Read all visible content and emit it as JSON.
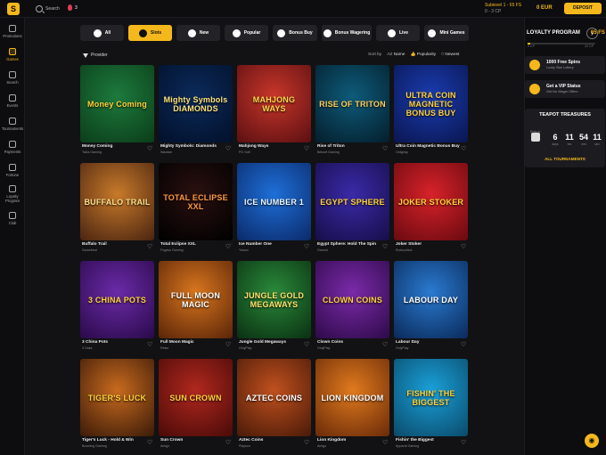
{
  "header": {
    "logo": "S",
    "search_label": "Search",
    "notifications_count": "3",
    "user_name": "Subievel 1 - 65 FS",
    "user_sub": "0 - 3 CP",
    "balance": "0 EUR",
    "deposit_label": "DEPOSIT"
  },
  "sidebar": {
    "items": [
      {
        "label": "Promotions"
      },
      {
        "label": "Games"
      },
      {
        "label": "Search"
      },
      {
        "label": "Events"
      },
      {
        "label": "Tournaments"
      },
      {
        "label": "Payments"
      },
      {
        "label": "Fortune"
      },
      {
        "label": "Loyalty Program"
      },
      {
        "label": "Club"
      }
    ]
  },
  "categories": [
    {
      "label": "All"
    },
    {
      "label": "Slots"
    },
    {
      "label": "New"
    },
    {
      "label": "Popular"
    },
    {
      "label": "Bonus Buy"
    },
    {
      "label": "Bonus Wagering"
    },
    {
      "label": "Live"
    },
    {
      "label": "Mini Games"
    }
  ],
  "filters": {
    "provider_label": "Provider",
    "sort_by": "Sort by",
    "sort_name": "Name",
    "sort_popularity": "Popularity",
    "sort_newest": "Newest"
  },
  "games": [
    {
      "title": "Money Coming",
      "provider": "TaDa Gaming",
      "art": "Money Coming",
      "bg": "#1d7a3c",
      "bg2": "#0b3d1a",
      "fg": "#ffd23a"
    },
    {
      "title": "Mighty Symbols: Diamonds",
      "provider": "Wazdan",
      "art": "Mighty Symbols DIAMONDS",
      "bg": "#0b2a5a",
      "bg2": "#02102a",
      "fg": "#ffe27a"
    },
    {
      "title": "Mahjong Ways",
      "provider": "PG Soft",
      "art": "MAHJONG WAYS",
      "bg": "#c8362a",
      "bg2": "#5b0f12",
      "fg": "#ffd84a"
    },
    {
      "title": "Rise of Triton",
      "provider": "Betsoft Gaming",
      "art": "RISE OF TRITON",
      "bg": "#0e5b7a",
      "bg2": "#041e2c",
      "fg": "#ffcf58"
    },
    {
      "title": "Ultra Coin Magnetic Bonus Buy",
      "provider": "Onlyplay",
      "art": "ULTRA COIN MAGNETIC BONUS BUY",
      "bg": "#1a3cb0",
      "bg2": "#0a1650",
      "fg": "#ffd23a"
    },
    {
      "title": "Buffalo Trail",
      "provider": "Gamebeat",
      "art": "BUFFALO TRAIL",
      "bg": "#c87a2a",
      "bg2": "#4a2410",
      "fg": "#ffe08a"
    },
    {
      "title": "Total Eclipse XXL",
      "provider": "Fugaso Gaming",
      "art": "TOTAL ECLIPSE XXL",
      "bg": "#2a1010",
      "bg2": "#000000",
      "fg": "#ff9a3c"
    },
    {
      "title": "Ice Number One",
      "provider": "Yowoo",
      "art": "ICE NUMBER 1",
      "bg": "#1e6fd8",
      "bg2": "#0b2a6a",
      "fg": "#e9f6ff"
    },
    {
      "title": "Egypt Sphere: Hold The Spin",
      "provider": "Gamzix",
      "art": "EGYPT SPHERE",
      "bg": "#3a2aa8",
      "bg2": "#160e4a",
      "fg": "#ffd23a"
    },
    {
      "title": "Joker Stoker",
      "provider": "Endorphina",
      "art": "JOKER STOKER",
      "bg": "#d8222a",
      "bg2": "#6a0a10",
      "fg": "#ffd23a"
    },
    {
      "title": "3 China Pots",
      "provider": "3 Oaks",
      "art": "3 CHINA POTS",
      "bg": "#6a2aa8",
      "bg2": "#2a0a4a",
      "fg": "#ffd23a"
    },
    {
      "title": "Full Moon Magic",
      "provider": "Relax",
      "art": "FULL MOON MAGIC",
      "bg": "#d8761e",
      "bg2": "#5a2408",
      "fg": "#ffffff"
    },
    {
      "title": "Jungle Gold Megaways",
      "provider": "OnlyPlay",
      "art": "JUNGLE GOLD MEGAWAYS",
      "bg": "#2a8a3a",
      "bg2": "#0a3012",
      "fg": "#ffe26a"
    },
    {
      "title": "Clown Coins",
      "provider": "OnlyPlay",
      "art": "CLOWN COINS",
      "bg": "#7a2aa8",
      "bg2": "#2e0a4a",
      "fg": "#ffd23a"
    },
    {
      "title": "Labour Day",
      "provider": "OnlyPlay",
      "art": "LABOUR DAY",
      "bg": "#2a7ad0",
      "bg2": "#0a2a5a",
      "fg": "#ffffff"
    },
    {
      "title": "Tiger's Luck - Hold & Win",
      "provider": "Booming Gaming",
      "art": "TIGER'S LUCK",
      "bg": "#c86a1e",
      "bg2": "#3a1a08",
      "fg": "#ffd23a"
    },
    {
      "title": "Sun Crown",
      "provider": "Amigo",
      "art": "SUN CROWN",
      "bg": "#b0281e",
      "bg2": "#4a0a08",
      "fg": "#ffd23a"
    },
    {
      "title": "Aztec Coins",
      "provider": "Playson",
      "art": "AZTEC COINS",
      "bg": "#c0501e",
      "bg2": "#4a1a08",
      "fg": "#ffffff"
    },
    {
      "title": "Lion Kingdom",
      "provider": "Amigo",
      "art": "LION KINGDOM",
      "bg": "#e07a1e",
      "bg2": "#6a2a08",
      "fg": "#ffffff"
    },
    {
      "title": "Fishin' the Biggest",
      "provider": "Apparat Gaming",
      "art": "FISHIN' THE BIGGEST",
      "bg": "#1aa0d8",
      "bg2": "#0a4a6a",
      "fg": "#ffd23a"
    }
  ],
  "right_panel": {
    "loyalty_title": "LOYALTY PROGRAM",
    "loyalty_fs": "65 FS",
    "progress_fraction": 0.04,
    "progress_left": "0 CP",
    "progress_right": "20 CP",
    "promos": [
      {
        "title": "1000 Free Spins",
        "sub": "Lucky Star Lottery"
      },
      {
        "title": "Get a VIP Status",
        "sub": "Get No Wager Offers"
      }
    ],
    "treasures_title": "TEAPOT TREASURES",
    "treasures_label": "Ends in",
    "countdown": [
      {
        "value": "6",
        "unit": "days"
      },
      {
        "value": "11",
        "unit": "hrs"
      },
      {
        "value": "54",
        "unit": "min"
      },
      {
        "value": "11",
        "unit": "sec"
      }
    ],
    "all_tournaments": "ALL TOURNAMENTS"
  },
  "colors": {
    "accent": "#f5b81c",
    "background": "#121214",
    "panel": "#0d0d0f"
  }
}
